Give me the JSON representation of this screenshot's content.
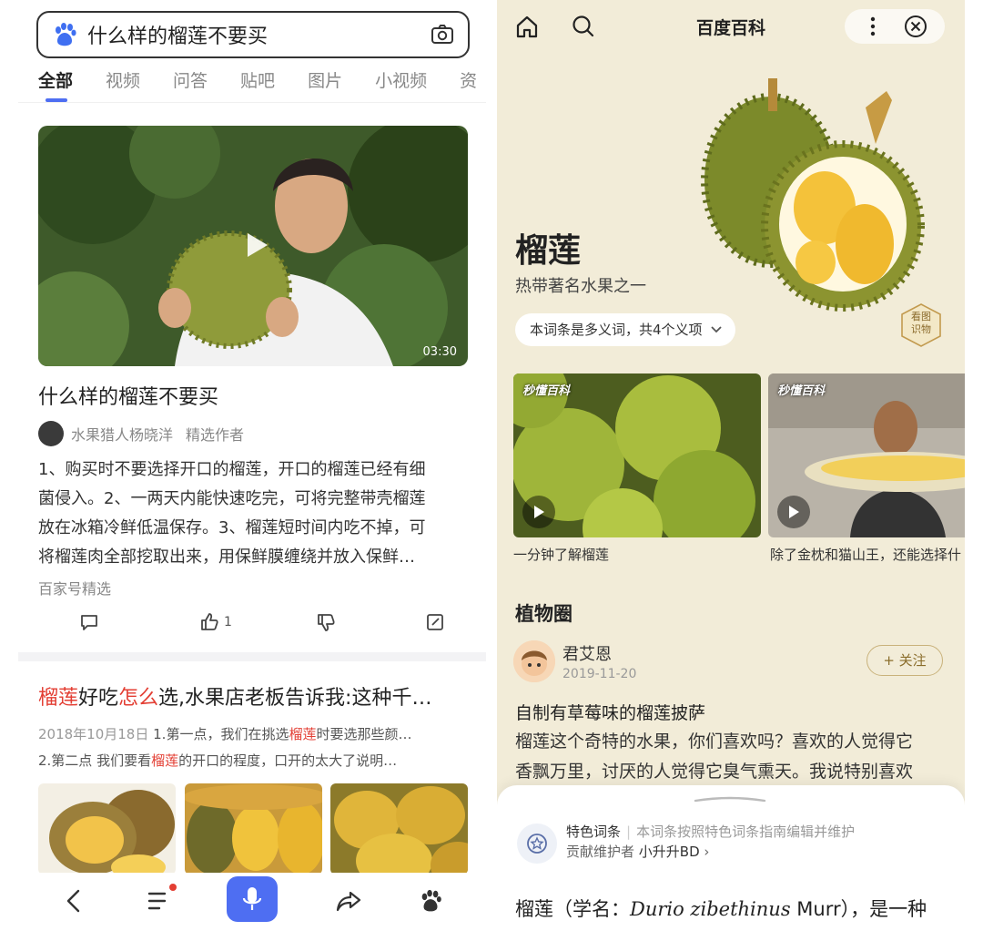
{
  "left": {
    "search": {
      "query": "什么样的榴莲不要买"
    },
    "tabs": [
      "全部",
      "视频",
      "问答",
      "贴吧",
      "图片",
      "小视频",
      "资"
    ],
    "result1": {
      "duration": "03:30",
      "title": "什么样的榴莲不要买",
      "author": "水果猎人杨晓洋",
      "author_tag": "精选作者",
      "abstract_lines": [
        "1、购买时不要选择开口的榴莲，开口的榴莲已经有细",
        "菌侵入。2、一两天内能快速吃完，可将完整带壳榴莲",
        "放在冰箱冷鲜低温保存。3、榴莲短时间内吃不掉，可",
        "将榴莲肉全部挖取出来，用保鲜膜缠绕并放入保鲜…"
      ],
      "source": "百家号精选",
      "like_count": "1"
    },
    "result2": {
      "title_hl1": "榴莲",
      "title_mid": "好吃",
      "title_hl2": "怎么",
      "title_rest": "选,水果店老板告诉我:这种千…",
      "date": "2018年10月18日",
      "line1_pre": "1.第一点，我们在挑选",
      "line1_hl": "榴莲",
      "line1_post": "时要选那些颜…",
      "line2_pre": "2.第二点 我们要看",
      "line2_hl": "榴莲",
      "line2_post": "的开口的程度，口开的太大了说明…"
    }
  },
  "right": {
    "header_title": "百度百科",
    "entry_name": "榴莲",
    "entry_sub": "热带著名水果之一",
    "polysemy": "本词条是多义词，共4个义项",
    "badge_line1": "看图",
    "badge_line2": "识物",
    "videos": [
      {
        "watermark": "秒懂百科",
        "caption": "一分钟了解榴莲"
      },
      {
        "watermark": "秒懂百科",
        "caption": "除了金枕和猫山王，还能选择什"
      }
    ],
    "section": "植物圈",
    "post": {
      "user": "君艾恩",
      "date": "2019-11-20",
      "follow": "关注",
      "title": "自制有草莓味的榴莲披萨",
      "lines": [
        "榴莲这个奇特的水果，你们喜欢吗？喜欢的人觉得它",
        "香飘万里，讨厌的人觉得它臭气熏天。我说特别喜欢"
      ]
    },
    "sheet": {
      "tag": "特色词条",
      "tag_desc": "本词条按照特色词条指南编辑并维护",
      "maintainer_label": "贡献维护者",
      "maintainer": "小升升BD",
      "def_pre": "榴莲（学名：",
      "def_latin": "Durio zibethinus",
      "def_post": " Murr），是一种"
    }
  },
  "colors": {
    "accent": "#4e6ef2",
    "highlight": "#e33e33",
    "baike_bg": "#f2ecd8"
  }
}
